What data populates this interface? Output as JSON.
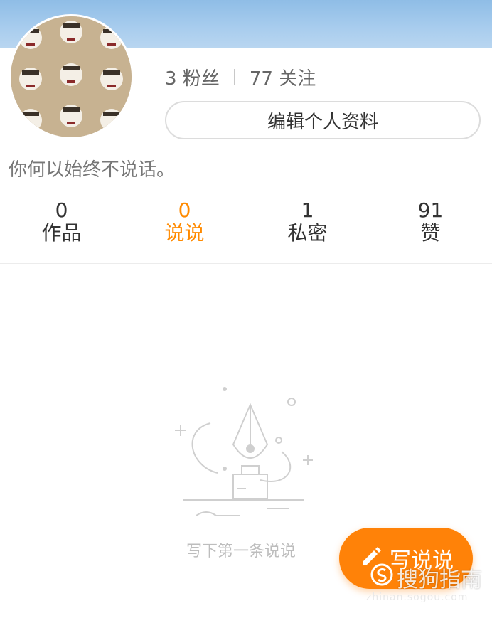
{
  "profile": {
    "followers_count": "3",
    "followers_label": "粉丝",
    "following_count": "77",
    "following_label": "关注",
    "edit_profile_label": "编辑个人资料",
    "signature": "你何以始终不说话。"
  },
  "tabs": [
    {
      "count": "0",
      "label": "作品"
    },
    {
      "count": "0",
      "label": "说说"
    },
    {
      "count": "1",
      "label": "私密"
    },
    {
      "count": "91",
      "label": "赞"
    }
  ],
  "active_tab_index": 1,
  "empty_state": {
    "message": "写下第一条说说",
    "illustration_icon": "fountain-pen-icon"
  },
  "write_button": {
    "label": "写说说",
    "icon": "pen-icon"
  },
  "watermark": {
    "text": "搜狗指南",
    "subtext": "zhinan.sogou.com"
  },
  "colors": {
    "accent": "#ff8208",
    "active_tab": "#ff8a00",
    "banner": "#a9cdee"
  }
}
